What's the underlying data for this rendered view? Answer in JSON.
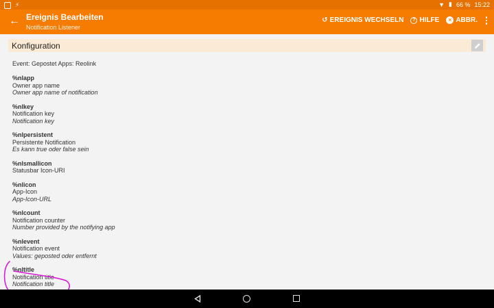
{
  "statusbar": {
    "battery": "66 %",
    "time": "15:22"
  },
  "appbar": {
    "title": "Ereignis Bearbeiten",
    "subtitle": "Notification Listener",
    "actions": {
      "switch": "EREIGNIS WECHSELN",
      "help": "HILFE",
      "cancel": "ABBR."
    }
  },
  "config": {
    "label": "Konfiguration"
  },
  "event_line": "Event: Gepostet Apps: Reolink",
  "variables": [
    {
      "name": "%nlapp",
      "desc1": "Owner app name",
      "desc2": "Owner app name of notification"
    },
    {
      "name": "%nlkey",
      "desc1": "Notification key",
      "desc2": "Notification key"
    },
    {
      "name": "%nlpersistent",
      "desc1": "Persistente Notification",
      "desc2": "Es kann true oder false sein"
    },
    {
      "name": "%nlsmallicon",
      "desc1": "Statusbar Icon-URI",
      "desc2": ""
    },
    {
      "name": "%nlicon",
      "desc1": "App-Icon",
      "desc2": "App-Icon-URL"
    },
    {
      "name": "%nlcount",
      "desc1": "Notification counter",
      "desc2": "Number provided by the notifying app"
    },
    {
      "name": "%nlevent",
      "desc1": "Notification event",
      "desc2": "Values: geposted oder entfernt"
    },
    {
      "name": "%nltitle",
      "desc1": "Notification title",
      "desc2": "Notification title"
    }
  ],
  "colors": {
    "appbar": "#f57c00",
    "statusbar": "#e67000",
    "config_bg": "#fbead6",
    "annotation": "#d81bd8"
  }
}
